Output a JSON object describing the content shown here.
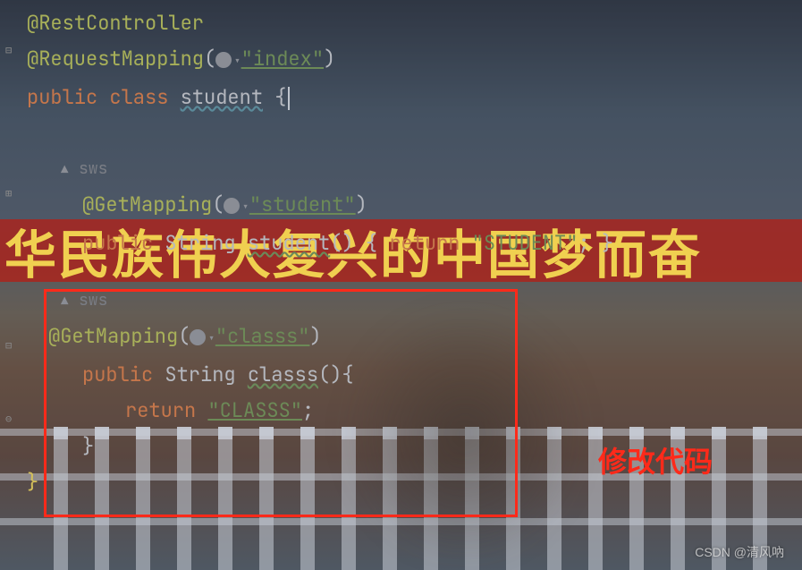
{
  "bg": {
    "banner_text": "华民族伟大复兴的中国梦而奋"
  },
  "code": {
    "anno_rest": "@RestController",
    "anno_reqmap": "@RequestMapping",
    "reqmap_val": "\"index\"",
    "kw_public": "public",
    "kw_class": "class",
    "class_name": "student",
    "author1": "sws",
    "anno_getmap1": "@GetMapping",
    "getmap1_val": "\"student\"",
    "type_string": "String",
    "method1": "student",
    "kw_return": "return",
    "ret1_val": "\"STUDENT\"",
    "author2": "sws",
    "anno_getmap2": "@GetMapping",
    "getmap2_val": "\"classs\"",
    "method2": "classs",
    "ret2_val": "\"CLASSS\""
  },
  "annotation": {
    "box_label": "修改代码"
  },
  "watermark": "CSDN @清风吶"
}
